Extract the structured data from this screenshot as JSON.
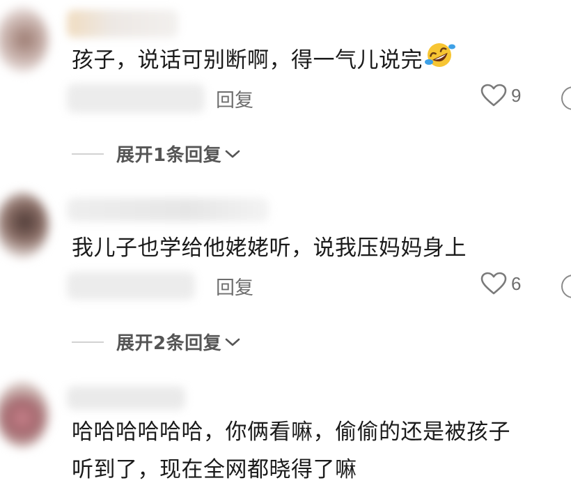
{
  "comments": [
    {
      "text": "孩子，说话可别断啊，得一气儿说完",
      "emoji": "rolling-on-floor-laughing",
      "reply_label": "回复",
      "likes": "9",
      "expand_label": "展开1条回复"
    },
    {
      "text": "我儿子也学给他姥姥听，说我压妈妈身上",
      "reply_label": "回复",
      "likes": "6",
      "expand_label": "展开2条回复"
    },
    {
      "text_line1": "哈哈哈哈哈哈，你俩看嘛，偷偷的还是被孩子",
      "text_line2": "听到了，现在全网都晓得了嘛"
    }
  ],
  "colors": {
    "text": "#1a1a1a",
    "muted": "#6e6e6e",
    "expand": "#555555",
    "background": "#ffffff"
  },
  "icons": [
    "heart-outline-icon",
    "chevron-down-icon",
    "laughing-emoji-icon"
  ]
}
